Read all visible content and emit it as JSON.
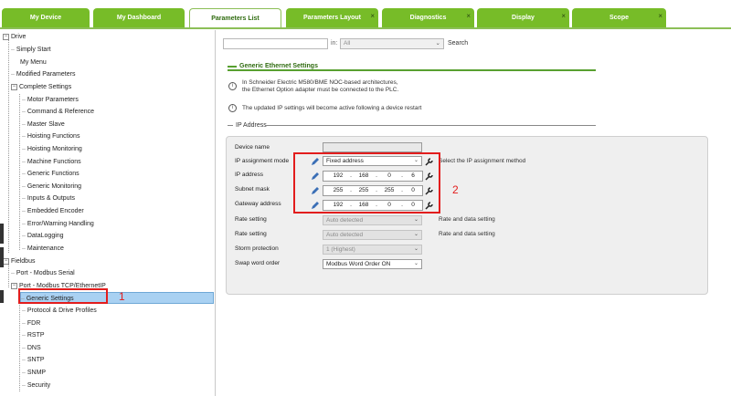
{
  "tabs": [
    {
      "label": "My Device",
      "closable": false,
      "active": false
    },
    {
      "label": "My Dashboard",
      "closable": false,
      "active": false
    },
    {
      "label": "Parameters List",
      "closable": false,
      "active": true
    },
    {
      "label": "Parameters Layout",
      "closable": true,
      "active": false
    },
    {
      "label": "Diagnostics",
      "closable": true,
      "active": false
    },
    {
      "label": "Display",
      "closable": true,
      "active": false
    },
    {
      "label": "Scope",
      "closable": true,
      "active": false
    }
  ],
  "close_glyph": "×",
  "tree": {
    "drive": "Drive",
    "simply_start": "Simply Start",
    "my_menu": "My Menu",
    "modified_parameters": "Modified Parameters",
    "complete_settings": "Complete Settings",
    "complete_items": [
      "Motor Parameters",
      "Command & Reference",
      "Master Slave",
      "Hoisting Functions",
      "Hoisting Monitoring",
      "Machine Functions",
      "Generic Functions",
      "Generic Monitoring",
      "Inputs & Outputs",
      "Embedded Encoder",
      "Error/Warning Handling",
      "DataLogging",
      "Maintenance"
    ],
    "fieldbus": "Fieldbus",
    "port_modbus_serial": "Port - Modbus Serial",
    "port_modbus_tcp": "Port - Modbus TCP/EthernetIP",
    "tcp_items": [
      "Generic Settings",
      "Protocol & Drive Profiles",
      "FDR",
      "RSTP",
      "DNS",
      "SNTP",
      "SNMP",
      "Security"
    ],
    "expander_open": "−"
  },
  "annotations": {
    "marker_1": "1",
    "marker_2": "2",
    "color": "#e21d1d"
  },
  "search": {
    "value": "",
    "in_label": "in:",
    "scope_value": "All",
    "button_label": "Search"
  },
  "section": {
    "title": "Generic Ethernet Settings",
    "info_1_line_1": "In Schneider Electric M580/BME NOC-based architectures,",
    "info_1_line_2": "the Ethernet Option adapter must be connected to the PLC.",
    "info_2": "The updated IP settings will become active following a device restart",
    "info_glyph": "i",
    "ip_header": "IP Address"
  },
  "params": {
    "device_name": {
      "label": "Device name",
      "value": ""
    },
    "ip_assignment": {
      "label": "IP assignment mode",
      "value": "Fixed address",
      "description": "Select the IP assignment method"
    },
    "ip_address": {
      "label": "IP address",
      "octets": [
        "192",
        "168",
        "0",
        "6"
      ]
    },
    "subnet_mask": {
      "label": "Subnet mask",
      "octets": [
        "255",
        "255",
        "255",
        "0"
      ]
    },
    "gateway": {
      "label": "Gateway address",
      "octets": [
        "192",
        "168",
        "0",
        "0"
      ]
    },
    "rate_1": {
      "label": "Rate setting",
      "value": "Auto detected",
      "description": "Rate and data setting"
    },
    "rate_2": {
      "label": "Rate setting",
      "value": "Auto detected",
      "description": "Rate and data setting"
    },
    "storm": {
      "label": "Storm protection",
      "value": "1 (Highest)"
    },
    "swap": {
      "label": "Swap word order",
      "value": "Modbus Word Order ON"
    }
  },
  "dropdown_glyph": "⌄",
  "colors": {
    "tab_green": "#77bc28",
    "section_green": "#2f6b0f",
    "selection_blue": "#a9d1f2"
  }
}
